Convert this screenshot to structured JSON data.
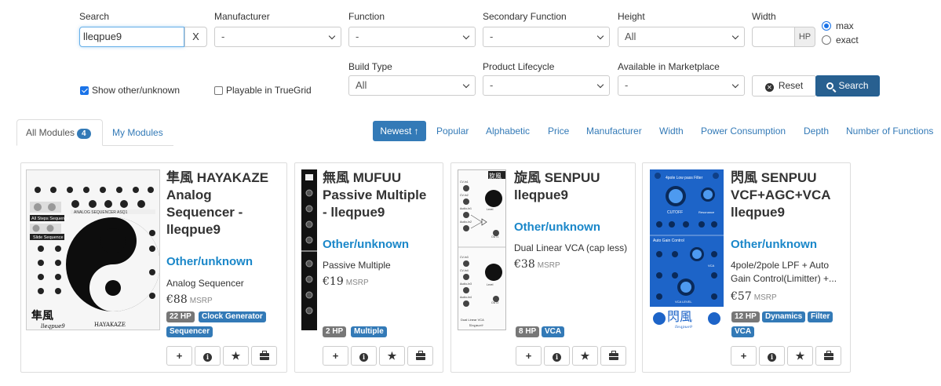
{
  "filters": {
    "search": {
      "label": "Search",
      "value": "lleqpue9",
      "clear": "X"
    },
    "manufacturer": {
      "label": "Manufacturer",
      "value": "-"
    },
    "function": {
      "label": "Function",
      "value": "-"
    },
    "secondary_function": {
      "label": "Secondary Function",
      "value": "-"
    },
    "height": {
      "label": "Height",
      "value": "All"
    },
    "width": {
      "label": "Width",
      "value": "",
      "unit": "HP",
      "max_label": "max",
      "exact_label": "exact",
      "selected": "max"
    },
    "build_type": {
      "label": "Build Type",
      "value": "All"
    },
    "product_lifecycle": {
      "label": "Product Lifecycle",
      "value": "-"
    },
    "marketplace": {
      "label": "Available in Marketplace",
      "value": "-"
    },
    "show_other": {
      "label": "Show other/unknown",
      "checked": true
    },
    "playable": {
      "label": "Playable in TrueGrid",
      "checked": false
    },
    "reset_label": "Reset",
    "search_label": "Search"
  },
  "tabs": {
    "all_label": "All Modules",
    "all_count": "4",
    "my_label": "My Modules"
  },
  "sort": {
    "newest": "Newest ↑",
    "popular": "Popular",
    "alphabetic": "Alphabetic",
    "price": "Price",
    "manufacturer": "Manufacturer",
    "width": "Width",
    "power": "Power Consumption",
    "depth": "Depth",
    "functions": "Number of Functions"
  },
  "modules": [
    {
      "title_l1": "隼風 HAYAKAZE",
      "title_l2": "Analog",
      "title_l3": "Sequencer -",
      "title_l4": "lleqpue9",
      "maker": "Other/unknown",
      "function": "Analog Sequencer",
      "price": "€88",
      "msrp": "MSRP",
      "hp": "22 HP",
      "tags": [
        "Clock Generator",
        "Sequencer"
      ],
      "panel_logo": "隼風",
      "panel_brand": "lleqpue9",
      "panel_name": "HAYAKAZE",
      "panel_strip_top": "ANALOG SEQUENCER ASQ1",
      "panel_strip_a": "All Steps Sequence",
      "panel_strip_b": "Slide Sequence"
    },
    {
      "title_l1": "無風 MUFUU",
      "title_l2": "Passive Multiple",
      "title_l3": "- lleqpue9",
      "maker": "Other/unknown",
      "function": "Passive Multiple",
      "price": "€19",
      "msrp": "MSRP",
      "hp": "2 HP",
      "tags": [
        "Multiple"
      ]
    },
    {
      "title_l1": "旋風 SENPUU",
      "title_l2": "lleqpue9",
      "maker": "Other/unknown",
      "function": "Dual Linear VCA (cap less)",
      "price": "€38",
      "msrp": "MSRP",
      "hp": "8 HP",
      "tags": [
        "VCA"
      ],
      "panel_logo": "旋風",
      "panel_caption": "Dual Linear VCA",
      "panel_brand": "lleqpue9",
      "panel_labels": [
        "CV-In1",
        "CV-In2",
        "Audio-In1",
        "Audio-In2",
        "Level",
        "OUT1",
        "CV-In3",
        "CV-In4",
        "Audio-In3",
        "Audio-In4",
        "Level",
        "OUT2"
      ]
    },
    {
      "title_l1": "閃風 SENPUU",
      "title_l2": "VCF+AGC+VCA",
      "title_l3": "lleqpue9",
      "maker": "Other/unknown",
      "function_l1": "4pole/2pole LPF + Auto",
      "function_l2": "Gain Control(Limitter) +...",
      "price": "€57",
      "msrp": "MSRP",
      "hp": "12 HP",
      "tags": [
        "Dynamics",
        "Filter",
        "VCA"
      ],
      "panel_logo": "閃風",
      "panel_brand": "lleqpue9",
      "panel_labels": [
        "4pole Low pass Filter",
        "CUTOFF",
        "Resonance",
        "Auto Gain Control",
        "VCA",
        "VCA LEVEL"
      ]
    }
  ],
  "actions": {
    "add": "+",
    "info": "i",
    "star": "★"
  },
  "colors": {
    "primary": "#337ab7",
    "maker": "#1a87c9",
    "panel_blue": "#1d64c8"
  }
}
